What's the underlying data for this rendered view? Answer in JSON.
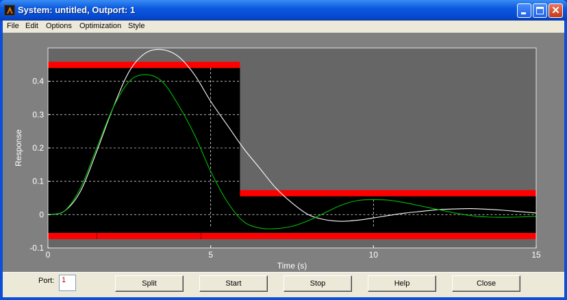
{
  "window": {
    "title": "System: untitled, Outport: 1"
  },
  "menu": [
    "File",
    "Edit",
    "Options",
    "Optimization",
    "Style"
  ],
  "controls": {
    "port_label": "Port:",
    "port_value": "1",
    "buttons": [
      "Split",
      "Start",
      "Stop",
      "Help",
      "Close"
    ]
  },
  "chart_data": {
    "type": "line",
    "xlabel": "Time (s)",
    "ylabel": "Response",
    "xlim": [
      0,
      15
    ],
    "ylim": [
      -0.1,
      0.5
    ],
    "x_ticks": [
      "0",
      "5",
      "10",
      "15"
    ],
    "y_ticks": [
      "-0.1",
      "0",
      "0.1",
      "0.2",
      "0.3",
      "0.4"
    ],
    "grid": "dashed white, inside feasible region",
    "background_colors": {
      "axes": "#666666",
      "feasible": "#000000",
      "constraint": "#ff0000",
      "window": "#808080"
    },
    "constraint_bounds": {
      "upper": [
        {
          "x": [
            0,
            5.9
          ],
          "y": 0.44
        },
        {
          "x": [
            5.9,
            15
          ],
          "y": 0.055
        }
      ],
      "lower": [
        {
          "x": [
            0,
            15
          ],
          "y": -0.055
        }
      ]
    },
    "series": [
      {
        "color": "#ffffff",
        "x": [
          0,
          0.5,
          1,
          1.5,
          2,
          2.5,
          3,
          3.5,
          4,
          4.5,
          5,
          5.5,
          6,
          6.5,
          7,
          7.5,
          8,
          8.5,
          9,
          9.5,
          10,
          10.5,
          11,
          11.5,
          12,
          12.5,
          13,
          13.5,
          14,
          14.5,
          15
        ],
        "y": [
          0,
          0.01,
          0.07,
          0.19,
          0.32,
          0.43,
          0.485,
          0.495,
          0.475,
          0.42,
          0.34,
          0.27,
          0.2,
          0.14,
          0.08,
          0.035,
          0.0,
          -0.015,
          -0.02,
          -0.017,
          -0.01,
          -0.002,
          0.005,
          0.01,
          0.015,
          0.017,
          0.018,
          0.016,
          0.013,
          0.009,
          0.005
        ]
      },
      {
        "color": "#00c000",
        "x": [
          0,
          0.5,
          1,
          1.5,
          2,
          2.5,
          3,
          3.5,
          4,
          4.5,
          5,
          5.5,
          6,
          6.5,
          7,
          7.5,
          8,
          8.5,
          9,
          9.5,
          10,
          10.5,
          11,
          11.5,
          12,
          12.5,
          13,
          13.5,
          14,
          14.5,
          15
        ],
        "y": [
          0,
          0.01,
          0.08,
          0.2,
          0.32,
          0.4,
          0.42,
          0.4,
          0.33,
          0.24,
          0.13,
          0.04,
          -0.02,
          -0.04,
          -0.042,
          -0.035,
          -0.018,
          0.005,
          0.028,
          0.042,
          0.045,
          0.043,
          0.035,
          0.025,
          0.015,
          0.005,
          -0.003,
          -0.007,
          -0.008,
          -0.007,
          -0.005
        ]
      }
    ],
    "markers": [
      {
        "x": 5.0,
        "y_from": -0.04,
        "y_to": 0.44
      },
      {
        "x": 10.0,
        "y_from": -0.04,
        "y_to": 0.045
      }
    ]
  }
}
